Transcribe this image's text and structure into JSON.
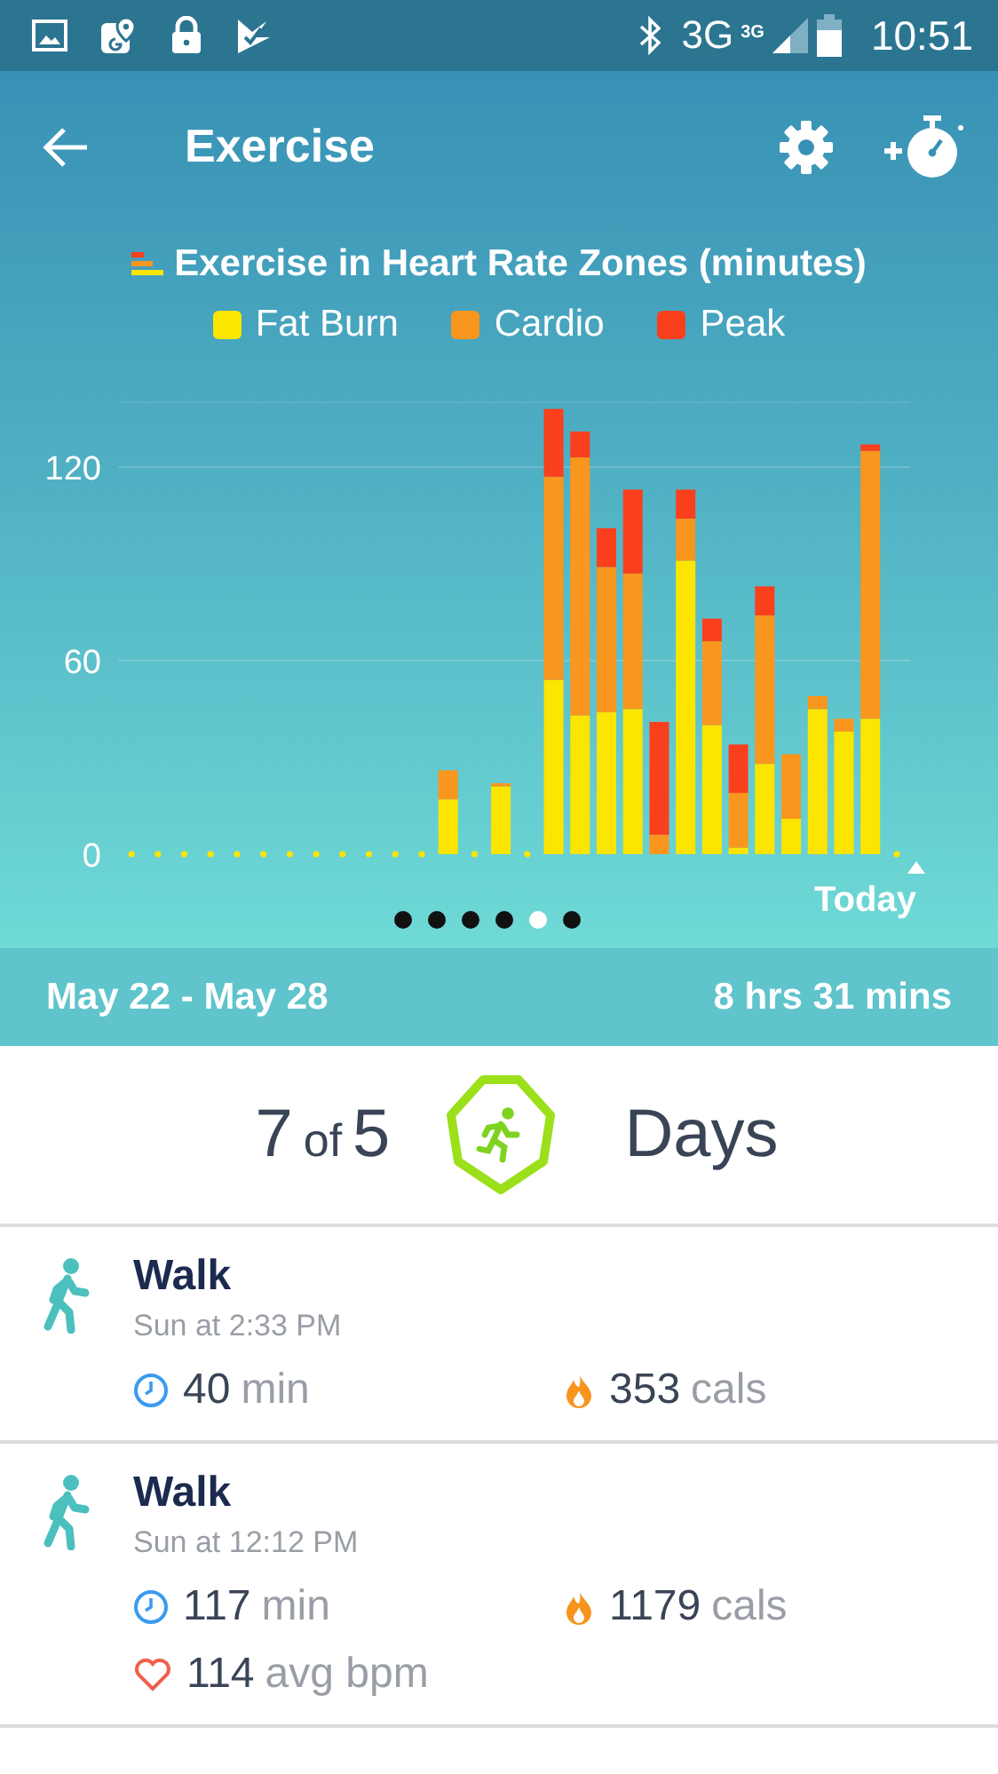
{
  "status_bar": {
    "network": "3G",
    "network_badge": "3G",
    "time": "10:51"
  },
  "app_bar": {
    "title": "Exercise"
  },
  "chart": {
    "chart_data": {
      "type": "bar",
      "stacked": true,
      "title": "Exercise in Heart Rate Zones (minutes)",
      "ylim": [
        0,
        140
      ],
      "yticks": [
        0,
        60,
        120
      ],
      "series": [
        {
          "name": "Fat Burn",
          "color": "#fce500",
          "values": [
            0,
            0,
            0,
            0,
            0,
            0,
            0,
            0,
            0,
            0,
            0,
            0,
            17,
            0,
            21,
            0,
            54,
            43,
            44,
            45,
            0,
            91,
            40,
            2,
            28,
            11,
            45,
            38,
            42,
            0
          ]
        },
        {
          "name": "Cardio",
          "color": "#f9961d",
          "values": [
            0,
            0,
            0,
            0,
            0,
            0,
            0,
            0,
            0,
            0,
            0,
            0,
            9,
            0,
            1,
            0,
            63,
            80,
            45,
            42,
            6,
            13,
            26,
            17,
            46,
            20,
            4,
            4,
            83,
            0
          ]
        },
        {
          "name": "Peak",
          "color": "#fa3f1c",
          "values": [
            0,
            0,
            0,
            0,
            0,
            0,
            0,
            0,
            0,
            0,
            0,
            0,
            0,
            0,
            0,
            0,
            21,
            8,
            12,
            26,
            35,
            9,
            7,
            15,
            9,
            0,
            0,
            0,
            2,
            0
          ]
        }
      ]
    },
    "today_label": "Today",
    "pages": [
      {
        "selected": false
      },
      {
        "selected": false
      },
      {
        "selected": false
      },
      {
        "selected": false
      },
      {
        "selected": true
      },
      {
        "selected": false
      }
    ]
  },
  "summary": {
    "range": "May 22 - May 28",
    "total": "8 hrs 31 mins"
  },
  "goal": {
    "achieved": "7",
    "of": "of",
    "target": "5",
    "unit": "Days"
  },
  "activities": [
    {
      "name": "Walk",
      "time": "Sun at 2:33 PM",
      "stats": [
        {
          "kind": "duration",
          "value": "40",
          "unit": "min"
        },
        {
          "kind": "calories",
          "value": "353",
          "unit": "cals"
        }
      ]
    },
    {
      "name": "Walk",
      "time": "Sun at 12:12 PM",
      "stats": [
        {
          "kind": "duration",
          "value": "117",
          "unit": "min"
        },
        {
          "kind": "calories",
          "value": "1179",
          "unit": "cals"
        },
        {
          "kind": "heart_rate",
          "value": "114",
          "unit": "avg bpm"
        }
      ]
    }
  ]
}
